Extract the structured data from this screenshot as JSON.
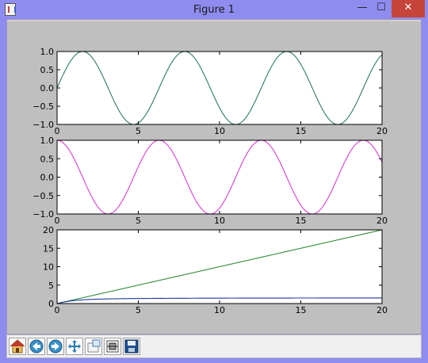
{
  "window": {
    "title": "Figure 1",
    "controls": {
      "minimize": "—",
      "maximize": "☐",
      "close": "✕"
    }
  },
  "chart_data": [
    {
      "type": "line",
      "xlim": [
        0,
        20
      ],
      "ylim": [
        -1.0,
        1.0
      ],
      "xticks": [
        "0",
        "5",
        "10",
        "15",
        "20"
      ],
      "yticks": [
        "1.0",
        "0.5",
        "0.0",
        "−0.5",
        "−1.0"
      ],
      "series": [
        {
          "function": "sin(x)",
          "x_range": [
            0,
            20
          ],
          "color": "#2e7d5f"
        }
      ]
    },
    {
      "type": "line",
      "xlim": [
        0,
        20
      ],
      "ylim": [
        -1.0,
        1.0
      ],
      "xticks": [
        "0",
        "5",
        "10",
        "15",
        "20"
      ],
      "yticks": [
        "1.0",
        "0.5",
        "0.0",
        "−0.5",
        "−1.0"
      ],
      "series": [
        {
          "function": "cos(x)",
          "x_range": [
            0,
            20
          ],
          "color": "#d63fd0"
        }
      ]
    },
    {
      "type": "line",
      "xlim": [
        0,
        20
      ],
      "ylim": [
        0,
        20
      ],
      "xticks": [
        "0",
        "5",
        "10",
        "15",
        "20"
      ],
      "yticks": [
        "20",
        "15",
        "10",
        "5",
        "0"
      ],
      "series": [
        {
          "function": "x",
          "x_range": [
            0,
            20
          ],
          "color": "#2e8b3a"
        },
        {
          "function": "arctan(x)",
          "x_range": [
            0,
            20
          ],
          "color": "#1f3aa0"
        }
      ]
    }
  ],
  "toolbar": {
    "buttons": [
      {
        "name": "home-icon"
      },
      {
        "name": "back-icon"
      },
      {
        "name": "forward-icon"
      },
      {
        "name": "pan-icon"
      },
      {
        "name": "zoom-icon"
      },
      {
        "name": "subplots-icon"
      },
      {
        "name": "save-icon"
      }
    ]
  }
}
